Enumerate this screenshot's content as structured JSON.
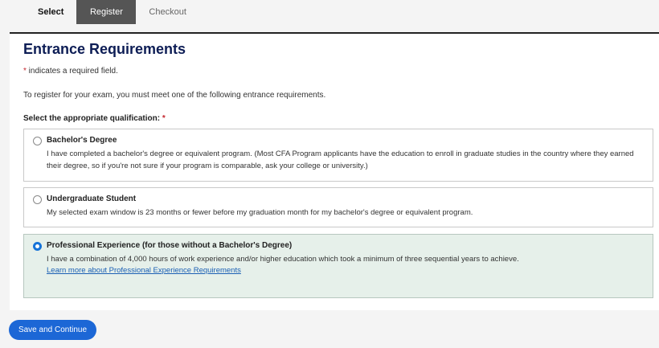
{
  "steps": {
    "select": "Select",
    "register": "Register",
    "checkout": "Checkout"
  },
  "colors": {
    "accent": "#1c67d6",
    "title": "#0d1d55",
    "required": "#c4262e",
    "selected_bg": "#e6f0ea"
  },
  "form": {
    "title": "Entrance Requirements",
    "required_star": "*",
    "required_note": " indicates a required field.",
    "intro": "To register for your exam, you must meet one of the following entrance requirements.",
    "question_label": "Select the appropriate qualification: ",
    "question_star": "*",
    "options": [
      {
        "title": "Bachelor's Degree",
        "description": "I have completed a bachelor's degree or equivalent program. (Most CFA Program applicants have the education to enroll in graduate studies in the country where they earned their degree, so if you're not sure if your program is comparable, ask your college or university.)",
        "checked": false
      },
      {
        "title": "Undergraduate Student",
        "description": "My selected exam window is 23 months or fewer before my graduation month for my bachelor's degree or equivalent program.",
        "checked": false
      },
      {
        "title": "Professional Experience (for those without a Bachelor's Degree)",
        "description": "I have a combination of 4,000 hours of work experience and/or higher education which took a minimum of three sequential years to achieve.",
        "link": "Learn more about Professional Experience Requirements",
        "checked": true
      }
    ]
  },
  "actions": {
    "save_label": "Save and Continue"
  }
}
